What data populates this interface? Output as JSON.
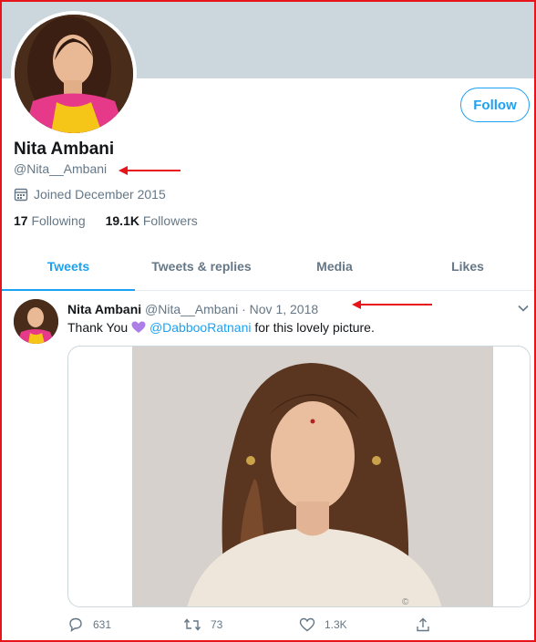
{
  "profile": {
    "name": "Nita Ambani",
    "handle": "@Nita__Ambani",
    "joined": "Joined December 2015",
    "following_count": "17",
    "following_label": "Following",
    "followers_count": "19.1K",
    "followers_label": "Followers",
    "follow_label": "Follow"
  },
  "tabs": [
    "Tweets",
    "Tweets & replies",
    "Media",
    "Likes"
  ],
  "tweet": {
    "name": "Nita Ambani",
    "handle": "@Nita__Ambani",
    "separator": "·",
    "date": "Nov 1, 2018",
    "text_before": "Thank You",
    "mention": "@DabbooRatnani",
    "text_after": "for this lovely picture.",
    "photo_watermark": "©",
    "replies": "631",
    "retweets": "73",
    "likes": "1.3K"
  },
  "colors": {
    "accent": "#1da1f2",
    "annotation": "#e8141c",
    "heart": "#ab7fe6"
  },
  "icons": [
    "calendar-icon",
    "chevron-down-icon",
    "purple-heart-icon",
    "reply-icon",
    "retweet-icon",
    "like-icon",
    "share-icon"
  ]
}
